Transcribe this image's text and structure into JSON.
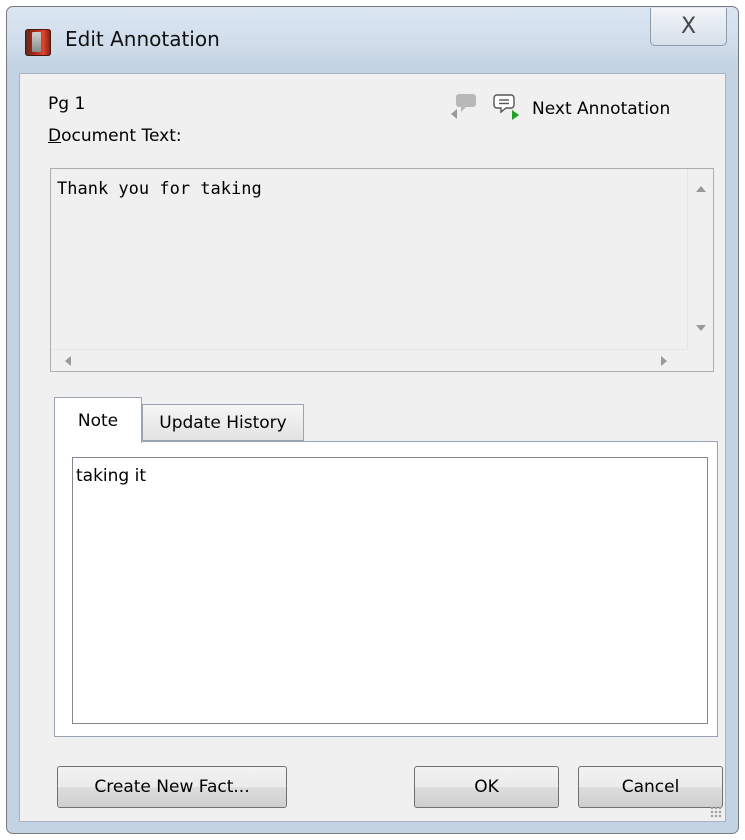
{
  "window": {
    "title": "Edit Annotation",
    "close_glyph": "X"
  },
  "header": {
    "page": "Pg 1",
    "document_text_label_first": "D",
    "document_text_label_rest": "ocument Text:",
    "next_annotation_label": "Next Annotation"
  },
  "document": {
    "text": "Thank you for taking"
  },
  "tabs": [
    {
      "label": "Note",
      "selected": true
    },
    {
      "label": "Update History",
      "selected": false
    }
  ],
  "note": {
    "text": "taking it"
  },
  "buttons": {
    "create_fact": "Create New Fact...",
    "ok": "OK",
    "cancel": "Cancel"
  },
  "icons": {
    "app": "app-icon",
    "prev_annotation": "previous-annotation-icon",
    "next_annotation": "next-annotation-icon"
  },
  "colors": {
    "next_arrow": "#22a022",
    "prev_arrow": "#9a9a9a"
  }
}
